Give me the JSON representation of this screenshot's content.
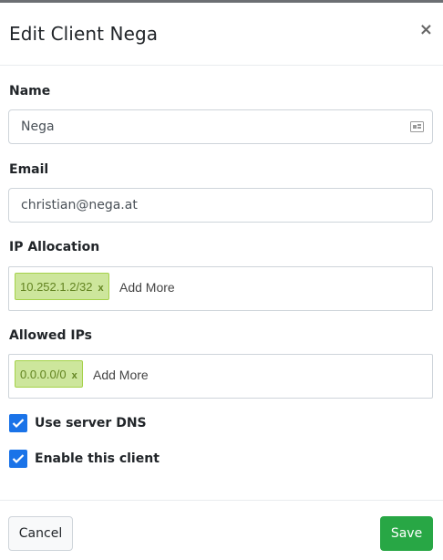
{
  "modal": {
    "title": "Edit Client Nega",
    "close_label": "×"
  },
  "fields": {
    "name": {
      "label": "Name",
      "value": "Nega"
    },
    "email": {
      "label": "Email",
      "value": "christian@nega.at"
    },
    "ip_allocation": {
      "label": "IP Allocation",
      "tags": [
        "10.252.1.2/32"
      ],
      "add_more": "Add More"
    },
    "allowed_ips": {
      "label": "Allowed IPs",
      "tags": [
        "0.0.0.0/0"
      ],
      "add_more": "Add More"
    }
  },
  "options": {
    "use_server_dns": {
      "label": "Use server DNS",
      "checked": true
    },
    "enable_client": {
      "label": "Enable this client",
      "checked": true
    }
  },
  "footer": {
    "cancel_label": "Cancel",
    "save_label": "Save"
  },
  "tag_remove": "x",
  "colors": {
    "save": "#28a745",
    "checkbox": "#1a73e8",
    "tag_bg": "#cde69c",
    "tag_border": "#a5d24a",
    "tag_text": "#638421"
  },
  "icons": {
    "name_field": "contact-card-icon",
    "checkbox": "checkmark-icon"
  }
}
